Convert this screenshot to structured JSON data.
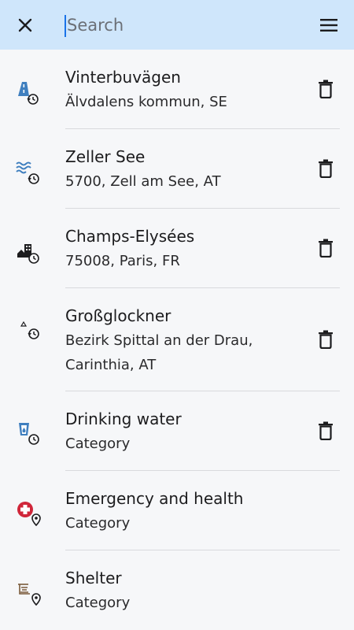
{
  "header": {
    "search_placeholder": "Search",
    "close_icon": "close-icon",
    "menu_icon": "menu-icon"
  },
  "colors": {
    "header_bg": "#cfe6fb",
    "accent_blue": "#3f7fbf",
    "emergency_red": "#d0263a",
    "shelter_brown": "#7a5a3a"
  },
  "items": [
    {
      "title": "Vinterbuvägen",
      "subtitle": "Älvdalens kommun, SE",
      "icon": "road-history-icon",
      "deletable": true
    },
    {
      "title": "Zeller See",
      "subtitle": "5700, Zell am See, AT",
      "icon": "water-history-icon",
      "deletable": true
    },
    {
      "title": "Champs-Elysées",
      "subtitle": "75008, Paris, FR",
      "icon": "city-history-icon",
      "deletable": true
    },
    {
      "title": "Großglockner",
      "subtitle": "Bezirk Spittal an der Drau, Carinthia, AT",
      "icon": "peak-history-icon",
      "deletable": true
    },
    {
      "title": "Drinking water",
      "subtitle": "Category",
      "icon": "drinking-water-history-icon",
      "deletable": true
    },
    {
      "title": "Emergency and health",
      "subtitle": "Category",
      "icon": "emergency-pin-icon",
      "deletable": false
    },
    {
      "title": "Shelter",
      "subtitle": "Category",
      "icon": "shelter-pin-icon",
      "deletable": false
    }
  ]
}
